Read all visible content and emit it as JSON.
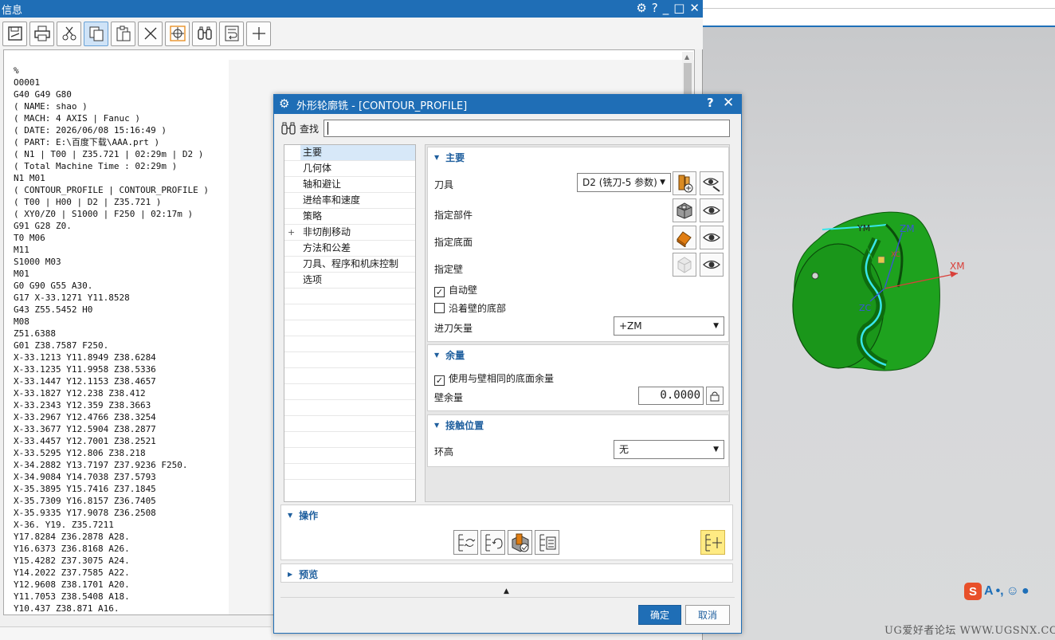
{
  "info_window": {
    "title": "信息",
    "controls": [
      "⚙",
      "?",
      "_",
      "□",
      "✕"
    ],
    "toolbar_icons": [
      "save-icon",
      "print-icon",
      "cut-icon",
      "copy-icon",
      "paste-icon",
      "delete-icon",
      "target-icon",
      "find-icon",
      "wrap-icon",
      "add-icon"
    ],
    "nc_lines": [
      "%",
      "O0001",
      "G40 G49 G80",
      "( NAME: shao )",
      "( MACH: 4 AXIS | Fanuc )",
      "( DATE: 2026/06/08 15:16:49 )",
      "( PART: E:\\百度下载\\AAA.prt )",
      "( N1 | T00 | Z35.721 | 02:29m | D2 )",
      "( Total Machine Time : 02:29m )",
      "N1 M01",
      "( CONTOUR_PROFILE | CONTOUR_PROFILE )",
      "( T00 | H00 | D2 | Z35.721 )",
      "( XY0/Z0 | S1000 | F250 | 02:17m )",
      "G91 G28 Z0.",
      "T0 M06",
      "M11",
      "S1000 M03",
      "M01",
      "G0 G90 G55 A30.",
      "G17 X-33.1271 Y11.8528",
      "G43 Z55.5452 H0",
      "M08",
      "Z51.6388",
      "G01 Z38.7587 F250.",
      "X-33.1213 Y11.8949 Z38.6284",
      "X-33.1235 Y11.9958 Z38.5336",
      "X-33.1447 Y12.1153 Z38.4657",
      "X-33.1827 Y12.238 Z38.412",
      "X-33.2343 Y12.359 Z38.3663",
      "X-33.2967 Y12.4766 Z38.3254",
      "X-33.3677 Y12.5904 Z38.2877",
      "X-33.4457 Y12.7001 Z38.2521",
      "X-33.5295 Y12.806 Z38.218",
      "X-34.2882 Y13.7197 Z37.9236 F250.",
      "X-34.9084 Y14.7038 Z37.5793",
      "X-35.3895 Y15.7416 Z37.1845",
      "X-35.7309 Y16.8157 Z36.7405",
      "X-35.9335 Y17.9078 Z36.2508",
      "X-36. Y19. Z35.7211",
      "Y17.8284 Z36.2878 A28.",
      "Y16.6373 Z36.8168 A26.",
      "Y15.4282 Z37.3075 A24.",
      "Y14.2022 Z37.7585 A22.",
      "Y12.9608 Z38.1701 A20.",
      "Y11.7053 Z38.5408 A18.",
      "Y10.437 Z38.871 A16."
    ]
  },
  "dialog": {
    "title": "外形轮廓铣 - [CONTOUR_PROFILE]",
    "help": "?",
    "close": "✕",
    "search_label": "查找",
    "nav_items": [
      "主要",
      "几何体",
      "轴和避让",
      "进给率和速度",
      "策略",
      "非切削移动",
      "方法和公差",
      "刀具、程序和机床控制",
      "选项"
    ],
    "main_group": {
      "title": "主要",
      "tool_label": "刀具",
      "tool_value": "D2 (铣刀-5 参数)",
      "part_label": "指定部件",
      "floor_label": "指定底面",
      "wall_label": "指定壁",
      "auto_wall_label": "自动壁",
      "auto_wall_checked": true,
      "along_wall_label": "沿着壁的底部",
      "along_wall_checked": false,
      "tool_axis_label": "进刀矢量",
      "tool_axis_value": "+ZM"
    },
    "stock_group": {
      "title": "余量",
      "same_floor_label": "使用与壁相同的底面余量",
      "same_floor_checked": true,
      "wall_stock_label": "壁余量",
      "wall_stock_value": "0.0000"
    },
    "contact_group": {
      "title": "接触位置",
      "ring_label": "环高",
      "ring_value": "无"
    },
    "operation_title": "操作",
    "preview_title": "预览",
    "ok_label": "确定",
    "cancel_label": "取消"
  },
  "viewport": {
    "axis_labels": {
      "xm": "XM",
      "zm": "ZM",
      "ym": "YM",
      "zc": "ZC",
      "xc": "XC"
    },
    "watermark": "UG爱好者论坛 WWW.UGSNX.COM",
    "ime_letter": "A",
    "ime_brand": "S"
  },
  "colors": {
    "accent": "#1f6eb6",
    "part_green": "#1fa31f",
    "toolpath_cyan": "#37e6ea"
  }
}
